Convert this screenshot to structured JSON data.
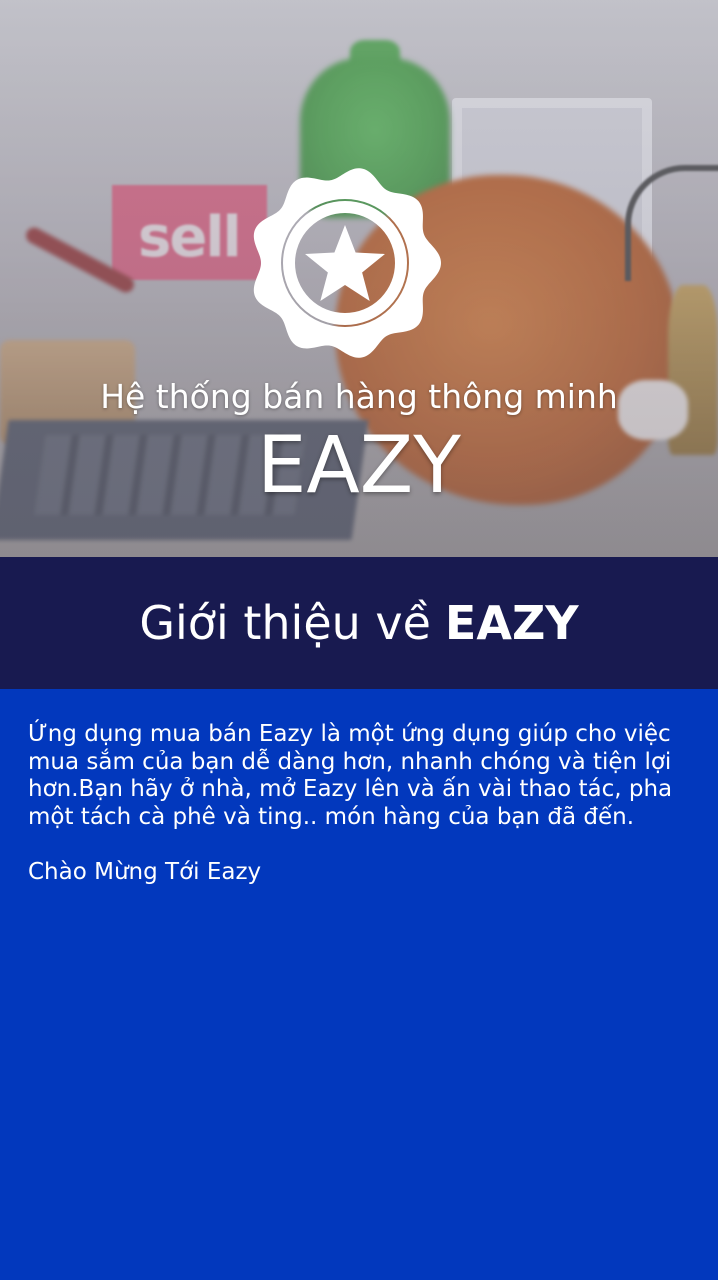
{
  "hero": {
    "tagline": "Hệ thống bán hàng thông minh",
    "brand": "EAZY",
    "badge_icon": "star-badge-icon",
    "background_text": "sell"
  },
  "header": {
    "title_prefix": "Giới thiệu về",
    "title_brand": "EAZY"
  },
  "content": {
    "description": "Ứng dụng mua bán Eazy là một ứng dụng giúp cho việc mua sắm của bạn dễ dàng hơn, nhanh chóng và tiện lợi hơn.Bạn hãy ở nhà, mở Eazy lên và ấn vài thao tác, pha một tách cà phê và ting.. món hàng của bạn đã đến.",
    "welcome": "Chào Mừng Tới Eazy"
  },
  "colors": {
    "content_background": "#0238bd",
    "title_bar_background": "#181a50",
    "text": "#ffffff"
  }
}
